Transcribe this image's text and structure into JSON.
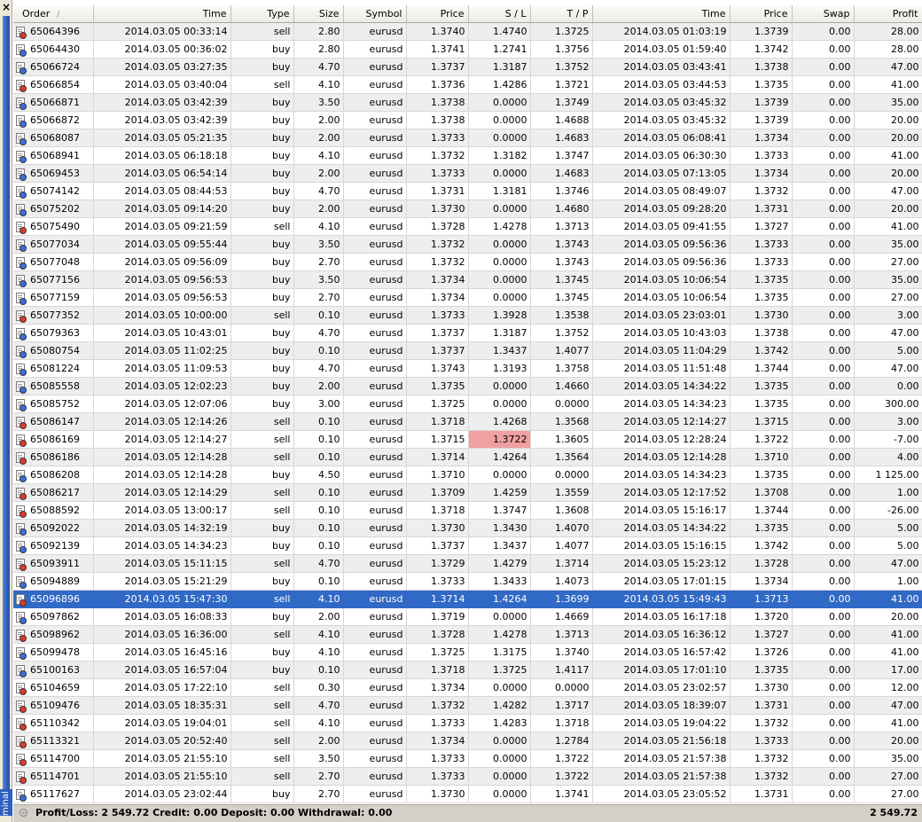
{
  "window": {
    "close_glyph": "×",
    "side_label": "minal"
  },
  "columns": [
    "Order",
    "Time",
    "Type",
    "Size",
    "Symbol",
    "Price",
    "S / L",
    "T / P",
    "Time",
    "Price",
    "Swap",
    "Profit"
  ],
  "sort_indicator": "/",
  "colors": {
    "selection": "#3169c6",
    "sl_highlight": "#f0a0a0",
    "buy_icon": "#3a6ee0",
    "sell_icon": "#e03a2a"
  },
  "icons": {
    "buy": "buy-order-icon",
    "sell": "sell-order-icon",
    "footer": "balance-icon"
  },
  "selected_order": "65096896",
  "highlighted_sl_order": "65086169",
  "rows": [
    {
      "order": "65064396",
      "open_time": "2014.03.05 00:33:14",
      "type": "sell",
      "size": "2.80",
      "symbol": "eurusd",
      "open_price": "1.3740",
      "sl": "1.4740",
      "tp": "1.3725",
      "close_time": "2014.03.05 01:03:19",
      "close_price": "1.3739",
      "swap": "0.00",
      "profit": "28.00"
    },
    {
      "order": "65064430",
      "open_time": "2014.03.05 00:36:02",
      "type": "buy",
      "size": "2.80",
      "symbol": "eurusd",
      "open_price": "1.3741",
      "sl": "1.2741",
      "tp": "1.3756",
      "close_time": "2014.03.05 01:59:40",
      "close_price": "1.3742",
      "swap": "0.00",
      "profit": "28.00"
    },
    {
      "order": "65066724",
      "open_time": "2014.03.05 03:27:35",
      "type": "buy",
      "size": "4.70",
      "symbol": "eurusd",
      "open_price": "1.3737",
      "sl": "1.3187",
      "tp": "1.3752",
      "close_time": "2014.03.05 03:43:41",
      "close_price": "1.3738",
      "swap": "0.00",
      "profit": "47.00"
    },
    {
      "order": "65066854",
      "open_time": "2014.03.05 03:40:04",
      "type": "sell",
      "size": "4.10",
      "symbol": "eurusd",
      "open_price": "1.3736",
      "sl": "1.4286",
      "tp": "1.3721",
      "close_time": "2014.03.05 03:44:53",
      "close_price": "1.3735",
      "swap": "0.00",
      "profit": "41.00"
    },
    {
      "order": "65066871",
      "open_time": "2014.03.05 03:42:39",
      "type": "buy",
      "size": "3.50",
      "symbol": "eurusd",
      "open_price": "1.3738",
      "sl": "0.0000",
      "tp": "1.3749",
      "close_time": "2014.03.05 03:45:32",
      "close_price": "1.3739",
      "swap": "0.00",
      "profit": "35.00"
    },
    {
      "order": "65066872",
      "open_time": "2014.03.05 03:42:39",
      "type": "buy",
      "size": "2.00",
      "symbol": "eurusd",
      "open_price": "1.3738",
      "sl": "0.0000",
      "tp": "1.4688",
      "close_time": "2014.03.05 03:45:32",
      "close_price": "1.3739",
      "swap": "0.00",
      "profit": "20.00"
    },
    {
      "order": "65068087",
      "open_time": "2014.03.05 05:21:35",
      "type": "buy",
      "size": "2.00",
      "symbol": "eurusd",
      "open_price": "1.3733",
      "sl": "0.0000",
      "tp": "1.4683",
      "close_time": "2014.03.05 06:08:41",
      "close_price": "1.3734",
      "swap": "0.00",
      "profit": "20.00"
    },
    {
      "order": "65068941",
      "open_time": "2014.03.05 06:18:18",
      "type": "buy",
      "size": "4.10",
      "symbol": "eurusd",
      "open_price": "1.3732",
      "sl": "1.3182",
      "tp": "1.3747",
      "close_time": "2014.03.05 06:30:30",
      "close_price": "1.3733",
      "swap": "0.00",
      "profit": "41.00"
    },
    {
      "order": "65069453",
      "open_time": "2014.03.05 06:54:14",
      "type": "buy",
      "size": "2.00",
      "symbol": "eurusd",
      "open_price": "1.3733",
      "sl": "0.0000",
      "tp": "1.4683",
      "close_time": "2014.03.05 07:13:05",
      "close_price": "1.3734",
      "swap": "0.00",
      "profit": "20.00"
    },
    {
      "order": "65074142",
      "open_time": "2014.03.05 08:44:53",
      "type": "buy",
      "size": "4.70",
      "symbol": "eurusd",
      "open_price": "1.3731",
      "sl": "1.3181",
      "tp": "1.3746",
      "close_time": "2014.03.05 08:49:07",
      "close_price": "1.3732",
      "swap": "0.00",
      "profit": "47.00"
    },
    {
      "order": "65075202",
      "open_time": "2014.03.05 09:14:20",
      "type": "buy",
      "size": "2.00",
      "symbol": "eurusd",
      "open_price": "1.3730",
      "sl": "0.0000",
      "tp": "1.4680",
      "close_time": "2014.03.05 09:28:20",
      "close_price": "1.3731",
      "swap": "0.00",
      "profit": "20.00"
    },
    {
      "order": "65075490",
      "open_time": "2014.03.05 09:21:59",
      "type": "sell",
      "size": "4.10",
      "symbol": "eurusd",
      "open_price": "1.3728",
      "sl": "1.4278",
      "tp": "1.3713",
      "close_time": "2014.03.05 09:41:55",
      "close_price": "1.3727",
      "swap": "0.00",
      "profit": "41.00"
    },
    {
      "order": "65077034",
      "open_time": "2014.03.05 09:55:44",
      "type": "buy",
      "size": "3.50",
      "symbol": "eurusd",
      "open_price": "1.3732",
      "sl": "0.0000",
      "tp": "1.3743",
      "close_time": "2014.03.05 09:56:36",
      "close_price": "1.3733",
      "swap": "0.00",
      "profit": "35.00"
    },
    {
      "order": "65077048",
      "open_time": "2014.03.05 09:56:09",
      "type": "buy",
      "size": "2.70",
      "symbol": "eurusd",
      "open_price": "1.3732",
      "sl": "0.0000",
      "tp": "1.3743",
      "close_time": "2014.03.05 09:56:36",
      "close_price": "1.3733",
      "swap": "0.00",
      "profit": "27.00"
    },
    {
      "order": "65077156",
      "open_time": "2014.03.05 09:56:53",
      "type": "buy",
      "size": "3.50",
      "symbol": "eurusd",
      "open_price": "1.3734",
      "sl": "0.0000",
      "tp": "1.3745",
      "close_time": "2014.03.05 10:06:54",
      "close_price": "1.3735",
      "swap": "0.00",
      "profit": "35.00"
    },
    {
      "order": "65077159",
      "open_time": "2014.03.05 09:56:53",
      "type": "buy",
      "size": "2.70",
      "symbol": "eurusd",
      "open_price": "1.3734",
      "sl": "0.0000",
      "tp": "1.3745",
      "close_time": "2014.03.05 10:06:54",
      "close_price": "1.3735",
      "swap": "0.00",
      "profit": "27.00"
    },
    {
      "order": "65077352",
      "open_time": "2014.03.05 10:00:00",
      "type": "sell",
      "size": "0.10",
      "symbol": "eurusd",
      "open_price": "1.3733",
      "sl": "1.3928",
      "tp": "1.3538",
      "close_time": "2014.03.05 23:03:01",
      "close_price": "1.3730",
      "swap": "0.00",
      "profit": "3.00"
    },
    {
      "order": "65079363",
      "open_time": "2014.03.05 10:43:01",
      "type": "buy",
      "size": "4.70",
      "symbol": "eurusd",
      "open_price": "1.3737",
      "sl": "1.3187",
      "tp": "1.3752",
      "close_time": "2014.03.05 10:43:03",
      "close_price": "1.3738",
      "swap": "0.00",
      "profit": "47.00"
    },
    {
      "order": "65080754",
      "open_time": "2014.03.05 11:02:25",
      "type": "buy",
      "size": "0.10",
      "symbol": "eurusd",
      "open_price": "1.3737",
      "sl": "1.3437",
      "tp": "1.4077",
      "close_time": "2014.03.05 11:04:29",
      "close_price": "1.3742",
      "swap": "0.00",
      "profit": "5.00"
    },
    {
      "order": "65081224",
      "open_time": "2014.03.05 11:09:53",
      "type": "buy",
      "size": "4.70",
      "symbol": "eurusd",
      "open_price": "1.3743",
      "sl": "1.3193",
      "tp": "1.3758",
      "close_time": "2014.03.05 11:51:48",
      "close_price": "1.3744",
      "swap": "0.00",
      "profit": "47.00"
    },
    {
      "order": "65085558",
      "open_time": "2014.03.05 12:02:23",
      "type": "buy",
      "size": "2.00",
      "symbol": "eurusd",
      "open_price": "1.3735",
      "sl": "0.0000",
      "tp": "1.4660",
      "close_time": "2014.03.05 14:34:22",
      "close_price": "1.3735",
      "swap": "0.00",
      "profit": "0.00"
    },
    {
      "order": "65085752",
      "open_time": "2014.03.05 12:07:06",
      "type": "buy",
      "size": "3.00",
      "symbol": "eurusd",
      "open_price": "1.3725",
      "sl": "0.0000",
      "tp": "0.0000",
      "close_time": "2014.03.05 14:34:23",
      "close_price": "1.3735",
      "swap": "0.00",
      "profit": "300.00"
    },
    {
      "order": "65086147",
      "open_time": "2014.03.05 12:14:26",
      "type": "sell",
      "size": "0.10",
      "symbol": "eurusd",
      "open_price": "1.3718",
      "sl": "1.4268",
      "tp": "1.3568",
      "close_time": "2014.03.05 12:14:27",
      "close_price": "1.3715",
      "swap": "0.00",
      "profit": "3.00"
    },
    {
      "order": "65086169",
      "open_time": "2014.03.05 12:14:27",
      "type": "sell",
      "size": "0.10",
      "symbol": "eurusd",
      "open_price": "1.3715",
      "sl": "1.3722",
      "tp": "1.3605",
      "close_time": "2014.03.05 12:28:24",
      "close_price": "1.3722",
      "swap": "0.00",
      "profit": "-7.00"
    },
    {
      "order": "65086186",
      "open_time": "2014.03.05 12:14:28",
      "type": "sell",
      "size": "0.10",
      "symbol": "eurusd",
      "open_price": "1.3714",
      "sl": "1.4264",
      "tp": "1.3564",
      "close_time": "2014.03.05 12:14:28",
      "close_price": "1.3710",
      "swap": "0.00",
      "profit": "4.00"
    },
    {
      "order": "65086208",
      "open_time": "2014.03.05 12:14:28",
      "type": "buy",
      "size": "4.50",
      "symbol": "eurusd",
      "open_price": "1.3710",
      "sl": "0.0000",
      "tp": "0.0000",
      "close_time": "2014.03.05 14:34:23",
      "close_price": "1.3735",
      "swap": "0.00",
      "profit": "1 125.00"
    },
    {
      "order": "65086217",
      "open_time": "2014.03.05 12:14:29",
      "type": "sell",
      "size": "0.10",
      "symbol": "eurusd",
      "open_price": "1.3709",
      "sl": "1.4259",
      "tp": "1.3559",
      "close_time": "2014.03.05 12:17:52",
      "close_price": "1.3708",
      "swap": "0.00",
      "profit": "1.00"
    },
    {
      "order": "65088592",
      "open_time": "2014.03.05 13:00:17",
      "type": "sell",
      "size": "0.10",
      "symbol": "eurusd",
      "open_price": "1.3718",
      "sl": "1.3747",
      "tp": "1.3608",
      "close_time": "2014.03.05 15:16:17",
      "close_price": "1.3744",
      "swap": "0.00",
      "profit": "-26.00"
    },
    {
      "order": "65092022",
      "open_time": "2014.03.05 14:32:19",
      "type": "buy",
      "size": "0.10",
      "symbol": "eurusd",
      "open_price": "1.3730",
      "sl": "1.3430",
      "tp": "1.4070",
      "close_time": "2014.03.05 14:34:22",
      "close_price": "1.3735",
      "swap": "0.00",
      "profit": "5.00"
    },
    {
      "order": "65092139",
      "open_time": "2014.03.05 14:34:23",
      "type": "buy",
      "size": "0.10",
      "symbol": "eurusd",
      "open_price": "1.3737",
      "sl": "1.3437",
      "tp": "1.4077",
      "close_time": "2014.03.05 15:16:15",
      "close_price": "1.3742",
      "swap": "0.00",
      "profit": "5.00"
    },
    {
      "order": "65093911",
      "open_time": "2014.03.05 15:11:15",
      "type": "sell",
      "size": "4.70",
      "symbol": "eurusd",
      "open_price": "1.3729",
      "sl": "1.4279",
      "tp": "1.3714",
      "close_time": "2014.03.05 15:23:12",
      "close_price": "1.3728",
      "swap": "0.00",
      "profit": "47.00"
    },
    {
      "order": "65094889",
      "open_time": "2014.03.05 15:21:29",
      "type": "buy",
      "size": "0.10",
      "symbol": "eurusd",
      "open_price": "1.3733",
      "sl": "1.3433",
      "tp": "1.4073",
      "close_time": "2014.03.05 17:01:15",
      "close_price": "1.3734",
      "swap": "0.00",
      "profit": "1.00"
    },
    {
      "order": "65096896",
      "open_time": "2014.03.05 15:47:30",
      "type": "sell",
      "size": "4.10",
      "symbol": "eurusd",
      "open_price": "1.3714",
      "sl": "1.4264",
      "tp": "1.3699",
      "close_time": "2014.03.05 15:49:43",
      "close_price": "1.3713",
      "swap": "0.00",
      "profit": "41.00"
    },
    {
      "order": "65097862",
      "open_time": "2014.03.05 16:08:33",
      "type": "buy",
      "size": "2.00",
      "symbol": "eurusd",
      "open_price": "1.3719",
      "sl": "0.0000",
      "tp": "1.4669",
      "close_time": "2014.03.05 16:17:18",
      "close_price": "1.3720",
      "swap": "0.00",
      "profit": "20.00"
    },
    {
      "order": "65098962",
      "open_time": "2014.03.05 16:36:00",
      "type": "sell",
      "size": "4.10",
      "symbol": "eurusd",
      "open_price": "1.3728",
      "sl": "1.4278",
      "tp": "1.3713",
      "close_time": "2014.03.05 16:36:12",
      "close_price": "1.3727",
      "swap": "0.00",
      "profit": "41.00"
    },
    {
      "order": "65099478",
      "open_time": "2014.03.05 16:45:16",
      "type": "buy",
      "size": "4.10",
      "symbol": "eurusd",
      "open_price": "1.3725",
      "sl": "1.3175",
      "tp": "1.3740",
      "close_time": "2014.03.05 16:57:42",
      "close_price": "1.3726",
      "swap": "0.00",
      "profit": "41.00"
    },
    {
      "order": "65100163",
      "open_time": "2014.03.05 16:57:04",
      "type": "buy",
      "size": "0.10",
      "symbol": "eurusd",
      "open_price": "1.3718",
      "sl": "1.3725",
      "tp": "1.4117",
      "close_time": "2014.03.05 17:01:10",
      "close_price": "1.3735",
      "swap": "0.00",
      "profit": "17.00"
    },
    {
      "order": "65104659",
      "open_time": "2014.03.05 17:22:10",
      "type": "sell",
      "size": "0.30",
      "symbol": "eurusd",
      "open_price": "1.3734",
      "sl": "0.0000",
      "tp": "0.0000",
      "close_time": "2014.03.05 23:02:57",
      "close_price": "1.3730",
      "swap": "0.00",
      "profit": "12.00"
    },
    {
      "order": "65109476",
      "open_time": "2014.03.05 18:35:31",
      "type": "sell",
      "size": "4.70",
      "symbol": "eurusd",
      "open_price": "1.3732",
      "sl": "1.4282",
      "tp": "1.3717",
      "close_time": "2014.03.05 18:39:07",
      "close_price": "1.3731",
      "swap": "0.00",
      "profit": "47.00"
    },
    {
      "order": "65110342",
      "open_time": "2014.03.05 19:04:01",
      "type": "sell",
      "size": "4.10",
      "symbol": "eurusd",
      "open_price": "1.3733",
      "sl": "1.4283",
      "tp": "1.3718",
      "close_time": "2014.03.05 19:04:22",
      "close_price": "1.3732",
      "swap": "0.00",
      "profit": "41.00"
    },
    {
      "order": "65113321",
      "open_time": "2014.03.05 20:52:40",
      "type": "sell",
      "size": "2.00",
      "symbol": "eurusd",
      "open_price": "1.3734",
      "sl": "0.0000",
      "tp": "1.2784",
      "close_time": "2014.03.05 21:56:18",
      "close_price": "1.3733",
      "swap": "0.00",
      "profit": "20.00"
    },
    {
      "order": "65114700",
      "open_time": "2014.03.05 21:55:10",
      "type": "sell",
      "size": "3.50",
      "symbol": "eurusd",
      "open_price": "1.3733",
      "sl": "0.0000",
      "tp": "1.3722",
      "close_time": "2014.03.05 21:57:38",
      "close_price": "1.3732",
      "swap": "0.00",
      "profit": "35.00"
    },
    {
      "order": "65114701",
      "open_time": "2014.03.05 21:55:10",
      "type": "sell",
      "size": "2.70",
      "symbol": "eurusd",
      "open_price": "1.3733",
      "sl": "0.0000",
      "tp": "1.3722",
      "close_time": "2014.03.05 21:57:38",
      "close_price": "1.3732",
      "swap": "0.00",
      "profit": "27.00"
    },
    {
      "order": "65117627",
      "open_time": "2014.03.05 23:02:44",
      "type": "buy",
      "size": "2.70",
      "symbol": "eurusd",
      "open_price": "1.3730",
      "sl": "0.0000",
      "tp": "1.3741",
      "close_time": "2014.03.05 23:05:52",
      "close_price": "1.3731",
      "swap": "0.00",
      "profit": "27.00"
    }
  ],
  "footer": {
    "summary": "Profit/Loss: 2 549.72  Credit: 0.00  Deposit: 0.00  Withdrawal: 0.00",
    "total": "2 549.72"
  }
}
